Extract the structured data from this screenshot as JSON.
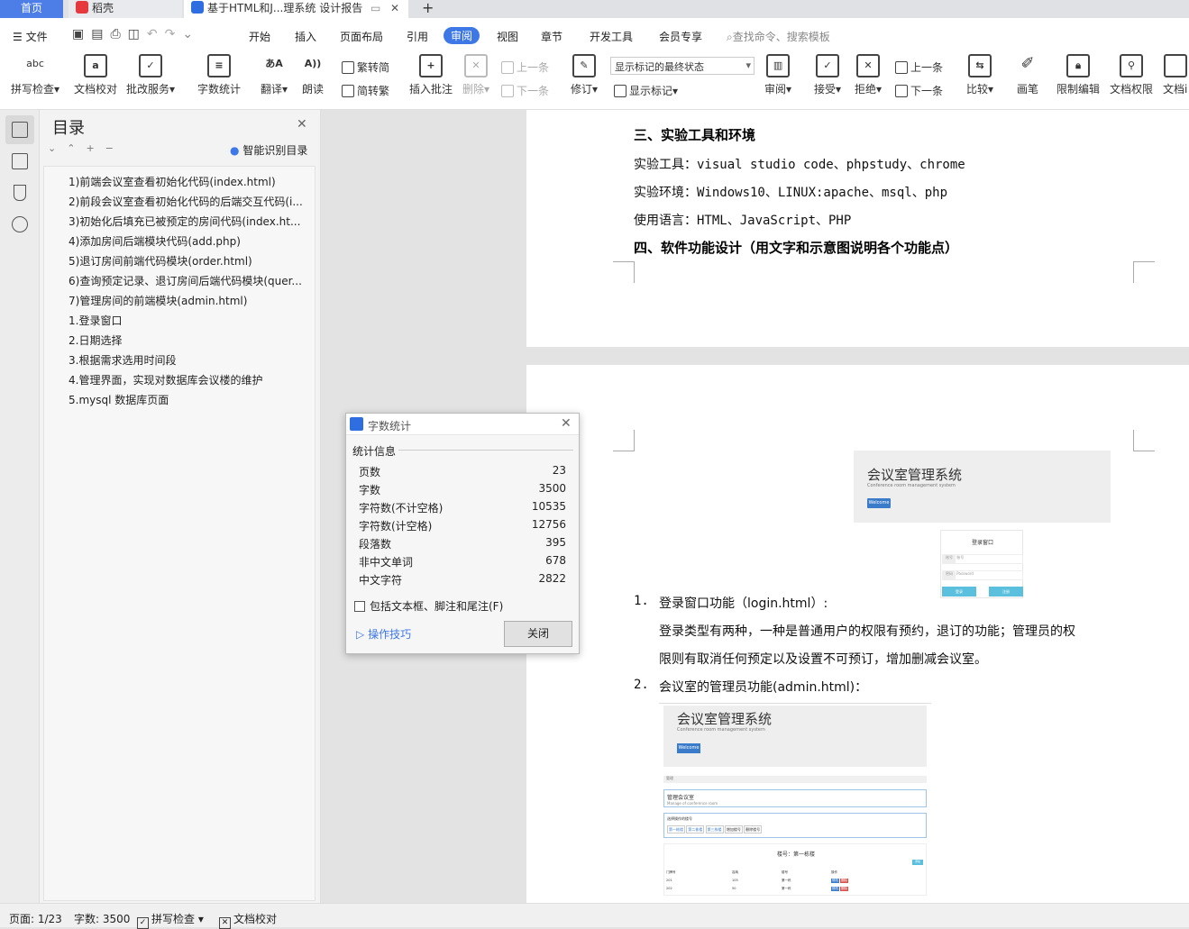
{
  "tabs": {
    "home": "首页",
    "daoke": "稻壳",
    "doc": "基于HTML和J...理系统 设计报告",
    "new_tab": "+"
  },
  "menu": {
    "file": "文件",
    "start": "开始",
    "insert": "插入",
    "layout": "页面布局",
    "reference": "引用",
    "review": "审阅",
    "view": "视图",
    "chapter": "章节",
    "devtools": "开发工具",
    "member": "会员专享",
    "search_placeholder": "查找命令、搜索模板"
  },
  "ribbon": {
    "spell": "拼写检查",
    "doc_check": "文档校对",
    "batch": "批改服务",
    "word_count": "字数统计",
    "translate": "翻译",
    "read": "朗读",
    "to_trad": "繁转简",
    "to_simp": "简转繁",
    "insert_comment": "插入批注",
    "delete": "删除",
    "prev_item": "上一条",
    "next_item": "下一条",
    "revise": "修订",
    "markup_select": "显示标记的最终状态",
    "show_markup": "显示标记",
    "review": "审阅",
    "accept": "接受",
    "reject": "拒绝",
    "prev": "上一条",
    "next": "下一条",
    "compare": "比较",
    "pen": "画笔",
    "restrict": "限制编辑",
    "permission": "文档权限",
    "doc_more": "文档i"
  },
  "toc": {
    "title": "目录",
    "smart": "智能识别目录",
    "items": [
      "1)前端会议室查看初始化代码(index.html)",
      "2)前段会议室查看初始化代码的后端交互代码(i...",
      "3)初始化后填充已被预定的房间代码(index.ht...",
      "4)添加房间后端模块代码(add.php)",
      "5)退订房间前端代码模块(order.html)",
      "6)查询预定记录、退订房间后端代码模块(quer...",
      "7)管理房间的前端模块(admin.html)",
      "1.登录窗口",
      "2.日期选择",
      "3.根据需求选用时间段",
      "4.管理界面，实现对数据库会议楼的维护",
      "5.mysql 数据库页面"
    ]
  },
  "doc": {
    "h3": "三、实验工具和环境",
    "tools_label": "实验工具：",
    "tools_value": "visual studio code、phpstudy、chrome",
    "env_label": "实验环境：",
    "env_value": "Windows10、LINUX:apache、msql、php",
    "lang_label": "使用语言：",
    "lang_value": "HTML、JavaScript、PHP",
    "h4": "四、软件功能设计（用文字和示意图说明各个功能点）",
    "item1_num": "1.",
    "item1": "登录窗口功能（login.html）:",
    "item1_desc1": "登录类型有两种，一种是普通用户的权限有预约，退订的功能；管理员的权",
    "item1_desc2": "限则有取消任何预定以及设置不可预订，增加删减会议室。",
    "item2_num": "2.",
    "item2": "会议室的管理员功能(admin.html)：",
    "shot_title": "会议室管理系统",
    "shot_sub": "Conference room management system",
    "shot_btn": "Welcome",
    "login_title": "登录窗口",
    "login_user": "账号",
    "login_pass": "密码",
    "login_user_ph": "账号",
    "login_pass_ph": "Password",
    "login_btn1": "登录",
    "login_btn2": "注册",
    "admin_bar": "管理",
    "admin_manage": "管理会议室",
    "admin_manage_sub": "Manage of conference room",
    "admin_select": "选择操作的楼号",
    "admin_floor_title": "楼号：第一栋楼",
    "admin_floor_btn": "添加",
    "admin_tabs": [
      "第一栋楼",
      "第二栋楼",
      "第三栋楼",
      "增加楼号",
      "删除楼号"
    ],
    "admin_cols": [
      "门牌号",
      "容纳",
      "楼号",
      "操作"
    ],
    "admin_rows": [
      [
        "201",
        "105",
        "第一栋",
        ""
      ],
      [
        "202",
        "50",
        "第一栋",
        ""
      ]
    ],
    "admin_action1": "修改",
    "admin_action2": "删除"
  },
  "dialog": {
    "title": "字数统计",
    "section": "统计信息",
    "rows": [
      {
        "label": "页数",
        "value": "23"
      },
      {
        "label": "字数",
        "value": "3500"
      },
      {
        "label": "字符数(不计空格)",
        "value": "10535"
      },
      {
        "label": "字符数(计空格)",
        "value": "12756"
      },
      {
        "label": "段落数",
        "value": "395"
      },
      {
        "label": "非中文单词",
        "value": "678"
      },
      {
        "label": "中文字符",
        "value": "2822"
      }
    ],
    "checkbox": "包括文本框、脚注和尾注(F)",
    "tips": "操作技巧",
    "close": "关闭"
  },
  "status": {
    "page": "页面: 1/23",
    "words": "字数: 3500",
    "spell": "拼写检查",
    "check": "文档校对"
  }
}
